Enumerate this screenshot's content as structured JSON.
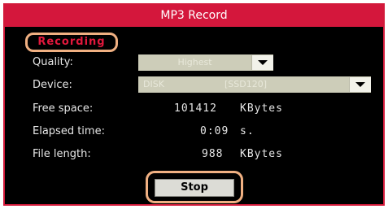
{
  "window": {
    "title": "MP3 Record"
  },
  "status": {
    "label": "Recording",
    "color": "#e2183c"
  },
  "quality": {
    "label": "Quality:",
    "value": "Highest"
  },
  "device": {
    "label": "Device:",
    "name": "DISK",
    "id": "[SSD120]"
  },
  "free_space": {
    "label": "Free space:",
    "value": "101412",
    "unit": "KBytes"
  },
  "elapsed": {
    "label": "Elapsed time:",
    "value": "0:09",
    "unit": "s."
  },
  "file_length": {
    "label": "File length:",
    "value": "988",
    "unit": "KBytes"
  },
  "actions": {
    "stop_label": "Stop"
  },
  "colors": {
    "accent": "#d4173c",
    "highlight": "#f0b082",
    "background": "#000000"
  }
}
